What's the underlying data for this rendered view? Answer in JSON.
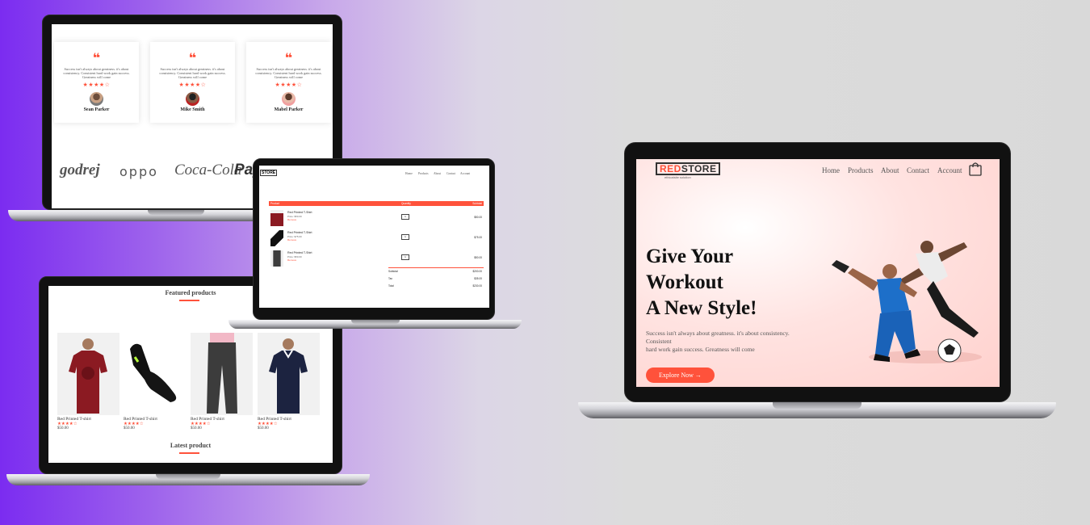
{
  "testimonials": {
    "items": [
      {
        "quote_mark": "66",
        "text": "Success isn't always about greatness. it's about consistency. Consistent hard work gain success. Greatness will come",
        "rating": "★★★★☆",
        "name": "Sean Parker"
      },
      {
        "quote_mark": "66",
        "text": "Success isn't always about greatness. it's about consistency. Consistent hard work gain success. Greatness will come",
        "rating": "★★★★☆",
        "name": "Mike Smith"
      },
      {
        "quote_mark": "66",
        "text": "Success isn't always about greatness. it's about consistency. Consistent hard work gain success. Greatness will come",
        "rating": "★★★★☆",
        "name": "Mabel Parker"
      }
    ],
    "brands": [
      "godrej",
      "oppo",
      "Coca-Cola",
      "Pay"
    ]
  },
  "cart": {
    "logo": "STORE",
    "nav": [
      "Home",
      "Products",
      "About",
      "Contact",
      "Account"
    ],
    "columns": {
      "product": "Product",
      "quantity": "Quantity",
      "subtotal": "Subtotal"
    },
    "rows": [
      {
        "name": "Red Printed T-Shirt",
        "price": "Price: $50.00",
        "remove": "Remove",
        "qty": "1",
        "subtotal": "$50.00"
      },
      {
        "name": "Red Printed T-Shirt",
        "price": "Price: $75.00",
        "remove": "Remove",
        "qty": "1",
        "subtotal": "$75.00"
      },
      {
        "name": "Red Printed T-Shirt",
        "price": "Price: $50.00",
        "remove": "Remove",
        "qty": "1",
        "subtotal": "$50.00"
      }
    ],
    "totals": [
      {
        "label": "Subtotal",
        "value": "$200.00"
      },
      {
        "label": "Tax",
        "value": "$35.00"
      },
      {
        "label": "Total",
        "value": "$230.00"
      }
    ]
  },
  "featured": {
    "title": "Featured products",
    "products": [
      {
        "name": "Red Printed T-shirt",
        "rating": "★★★★☆",
        "price": "$50.00"
      },
      {
        "name": "Red Printed T-shirt",
        "rating": "★★★★☆",
        "price": "$50.00"
      },
      {
        "name": "Red Printed T-shirt",
        "rating": "★★★★☆",
        "price": "$50.00"
      },
      {
        "name": "Red Printed T-shirt",
        "rating": "★★★★☆",
        "price": "$50.00"
      }
    ],
    "latest_title": "Latest product"
  },
  "hero": {
    "logo_red": "RED",
    "logo_rest": "STORE",
    "logo_tag": "ethicalsite solution",
    "nav": [
      "Home",
      "Products",
      "About",
      "Contact",
      "Account"
    ],
    "title_line1": "Give Your",
    "title_line2": "Workout",
    "title_line3": "A New Style!",
    "subtitle_line1": "Success isn't always about greatness. it's about consistency.",
    "subtitle_line2": "Consistent",
    "subtitle_line3": "hard work gain success. Greatness will come",
    "cta": "Explore Now →",
    "accent": "#ff523b",
    "hero_bg": "#ffd6d6"
  }
}
